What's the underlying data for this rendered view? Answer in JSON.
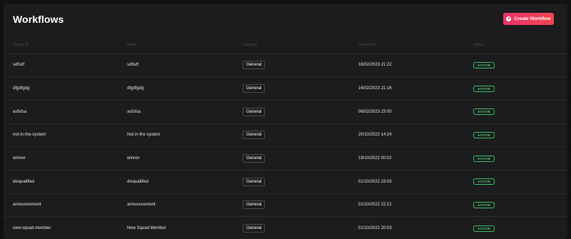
{
  "header": {
    "title": "Workflows",
    "create_button_label": "Create Workflow"
  },
  "table": {
    "columns": [
      "Trigger ID",
      "Name",
      "Category",
      "Created At",
      "Status"
    ],
    "rows": [
      {
        "trigger_id": "sdfsdf",
        "name": "sdfsdf",
        "category": "General",
        "created_at": "16/02/2023 21:22",
        "status": "ACTIVE"
      },
      {
        "trigger_id": "dfgdfgdg",
        "name": "dfgdfgdg",
        "category": "General",
        "created_at": "16/02/2023 21:16",
        "status": "ACTIVE"
      },
      {
        "trigger_id": "asfsfsa",
        "name": "asfsfsa",
        "category": "General",
        "created_at": "06/02/2023 23:00",
        "status": "ACTIVE"
      },
      {
        "trigger_id": "not-in-the-system",
        "name": "Not in the system",
        "category": "General",
        "created_at": "20/10/2022 14:24",
        "status": "ACTIVE"
      },
      {
        "trigger_id": "winner",
        "name": "winner",
        "category": "General",
        "created_at": "19/10/2022 00:02",
        "status": "ACTIVE"
      },
      {
        "trigger_id": "disqualified",
        "name": "disqualified",
        "category": "General",
        "created_at": "01/10/2022 23:03",
        "status": "ACTIVE"
      },
      {
        "trigger_id": "announcement",
        "name": "announcement",
        "category": "General",
        "created_at": "01/10/2022 22:21",
        "status": "ACTIVE"
      },
      {
        "trigger_id": "new-squad-member",
        "name": "New Squad Member",
        "category": "General",
        "created_at": "01/10/2022 20:03",
        "status": "ACTIVE"
      }
    ]
  },
  "colors": {
    "background": "#111114",
    "panel": "#1c1c1f",
    "accent_start": "#e8356a",
    "accent_end": "#f0454e",
    "status_active": "#38c25a"
  },
  "icons": {
    "create_button_icon": "plus-circle-icon"
  }
}
